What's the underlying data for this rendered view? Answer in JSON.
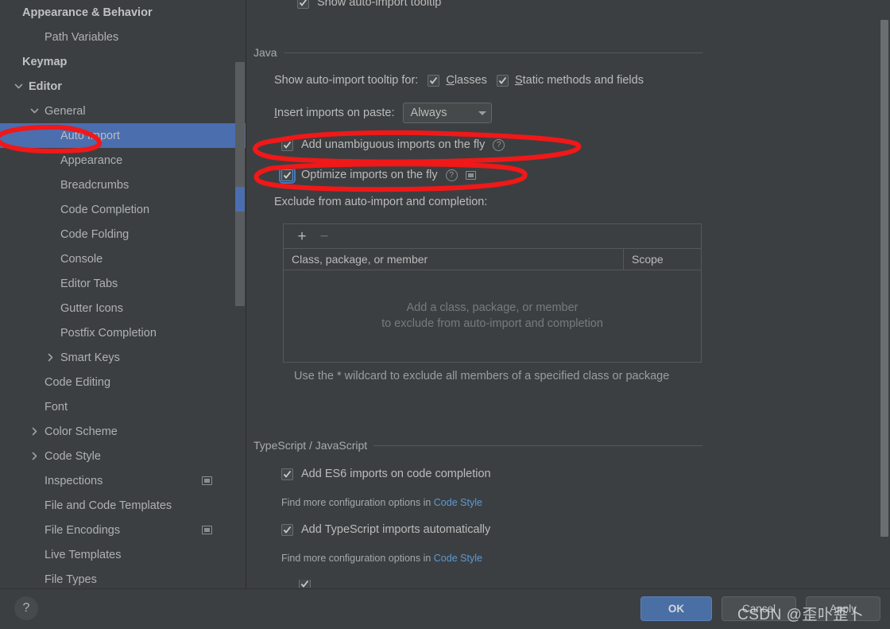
{
  "sidebar": {
    "items": [
      {
        "label": "Appearance & Behavior",
        "indent": 28,
        "bold": true,
        "arrow": "none",
        "trailing": false,
        "selected": false
      },
      {
        "label": "Path Variables",
        "indent": 56,
        "bold": false,
        "arrow": "none",
        "trailing": false,
        "selected": false
      },
      {
        "label": "Keymap",
        "indent": 28,
        "bold": true,
        "arrow": "none",
        "trailing": false,
        "selected": false
      },
      {
        "label": "Editor",
        "indent": 36,
        "bold": true,
        "arrow": "expanded",
        "trailing": false,
        "selected": false
      },
      {
        "label": "General",
        "indent": 56,
        "bold": false,
        "arrow": "expanded",
        "trailing": false,
        "selected": false
      },
      {
        "label": "Auto Import",
        "indent": 76,
        "bold": false,
        "arrow": "none",
        "trailing": false,
        "selected": true
      },
      {
        "label": "Appearance",
        "indent": 76,
        "bold": false,
        "arrow": "none",
        "trailing": false,
        "selected": false
      },
      {
        "label": "Breadcrumbs",
        "indent": 76,
        "bold": false,
        "arrow": "none",
        "trailing": false,
        "selected": false
      },
      {
        "label": "Code Completion",
        "indent": 76,
        "bold": false,
        "arrow": "none",
        "trailing": false,
        "selected": false
      },
      {
        "label": "Code Folding",
        "indent": 76,
        "bold": false,
        "arrow": "none",
        "trailing": false,
        "selected": false
      },
      {
        "label": "Console",
        "indent": 76,
        "bold": false,
        "arrow": "none",
        "trailing": false,
        "selected": false
      },
      {
        "label": "Editor Tabs",
        "indent": 76,
        "bold": false,
        "arrow": "none",
        "trailing": false,
        "selected": false
      },
      {
        "label": "Gutter Icons",
        "indent": 76,
        "bold": false,
        "arrow": "none",
        "trailing": false,
        "selected": false
      },
      {
        "label": "Postfix Completion",
        "indent": 76,
        "bold": false,
        "arrow": "none",
        "trailing": false,
        "selected": false
      },
      {
        "label": "Smart Keys",
        "indent": 76,
        "bold": false,
        "arrow": "collapsed",
        "trailing": false,
        "selected": false
      },
      {
        "label": "Code Editing",
        "indent": 56,
        "bold": false,
        "arrow": "none",
        "trailing": false,
        "selected": false
      },
      {
        "label": "Font",
        "indent": 56,
        "bold": false,
        "arrow": "none",
        "trailing": false,
        "selected": false
      },
      {
        "label": "Color Scheme",
        "indent": 56,
        "bold": false,
        "arrow": "collapsed",
        "trailing": false,
        "selected": false
      },
      {
        "label": "Code Style",
        "indent": 56,
        "bold": false,
        "arrow": "collapsed",
        "trailing": false,
        "selected": false
      },
      {
        "label": "Inspections",
        "indent": 56,
        "bold": false,
        "arrow": "none",
        "trailing": true,
        "selected": false
      },
      {
        "label": "File and Code Templates",
        "indent": 56,
        "bold": false,
        "arrow": "none",
        "trailing": false,
        "selected": false
      },
      {
        "label": "File Encodings",
        "indent": 56,
        "bold": false,
        "arrow": "none",
        "trailing": true,
        "selected": false
      },
      {
        "label": "Live Templates",
        "indent": 56,
        "bold": false,
        "arrow": "none",
        "trailing": false,
        "selected": false
      },
      {
        "label": "File Types",
        "indent": 56,
        "bold": false,
        "arrow": "none",
        "trailing": false,
        "selected": false
      }
    ]
  },
  "main": {
    "top_checkbox": {
      "label": "Show auto-import tooltip",
      "checked": true
    },
    "java_section": {
      "title": "Java",
      "tooltip_for_label": "Show auto-import tooltip for:",
      "tooltip_for_options": [
        {
          "label": "Classes",
          "mnemonic": "C",
          "checked": true
        },
        {
          "label": "Static methods and fields",
          "mnemonic": "S",
          "checked": true
        }
      ],
      "insert_imports_label": "Insert imports on paste:",
      "insert_imports_mnemonic": "I",
      "insert_imports_value": "Always",
      "checkboxes": [
        {
          "label": "Add unambiguous imports on the fly",
          "checked": true,
          "focused": false,
          "help": true,
          "trailing_icon": false
        },
        {
          "label": "Optimize imports on the fly",
          "checked": true,
          "focused": true,
          "help": true,
          "trailing_icon": true
        }
      ],
      "exclude_label": "Exclude from auto-import and completion:",
      "table": {
        "add_button": "+",
        "remove_button": "−",
        "columns": [
          "Class, package, or member",
          "Scope"
        ],
        "empty_line1": "Add a class, package, or member",
        "empty_line2": "to exclude from auto-import and completion",
        "rows": []
      },
      "wildcard_hint": "Use the * wildcard to exclude all members of a specified class or package"
    },
    "ts_section": {
      "title": "TypeScript / JavaScript",
      "items": [
        {
          "label": "Add ES6 imports on code completion",
          "checked": true,
          "hint_prefix": "Find more configuration options in ",
          "hint_link": "Code Style"
        },
        {
          "label": "Add TypeScript imports automatically",
          "checked": true,
          "hint_prefix": "Find more configuration options in ",
          "hint_link": "Code Style"
        }
      ]
    }
  },
  "bottom": {
    "help_label": "?",
    "ok_label": "OK",
    "cancel_label": "Cancel",
    "apply_label": "Apply",
    "watermark": "CSDN @歪卟歪卜"
  },
  "colors": {
    "window_bg": "#3c3f41",
    "selection_blue": "#4b6eaf",
    "accent_button": "#4a6fa5",
    "link_blue": "#5b9ad6",
    "annotation_red": "#f01818",
    "text": "#bbbbbb"
  }
}
